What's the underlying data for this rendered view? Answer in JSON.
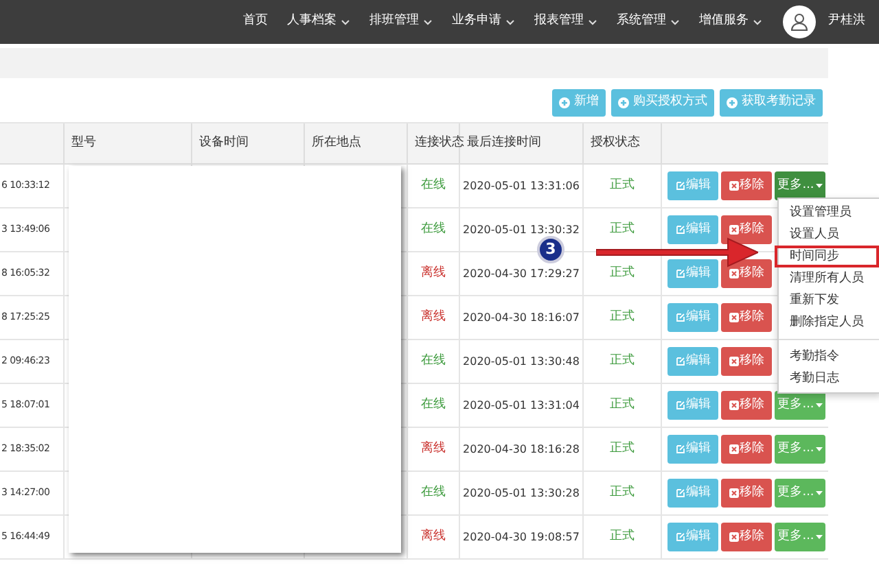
{
  "nav": {
    "items": [
      {
        "label": "首页",
        "dropdown": false
      },
      {
        "label": "人事档案",
        "dropdown": true
      },
      {
        "label": "排班管理",
        "dropdown": true
      },
      {
        "label": "业务申请",
        "dropdown": true
      },
      {
        "label": "报表管理",
        "dropdown": true
      },
      {
        "label": "系统管理",
        "dropdown": true
      },
      {
        "label": "增值服务",
        "dropdown": true
      }
    ],
    "user": "尹桂洪"
  },
  "toolbar": [
    "新增",
    "购买授权方式",
    "获取考勤记录"
  ],
  "table": {
    "columns": [
      "型号",
      "设备时间",
      "所在地点",
      "连接状态",
      "最后连接时间",
      "授权状态"
    ],
    "rows": [
      {
        "column_1": "6 10:33:12",
        "online": true,
        "status": "在线",
        "last_connected": "2020-05-01 13:31:06",
        "auth": "正式",
        "edit": "编辑",
        "remove": "移除",
        "more": {
          "label": "更多...",
          "selected": true
        }
      },
      {
        "column_1": "3 13:49:06",
        "online": true,
        "status": "在线",
        "last_connected": "2020-05-01 13:30:32",
        "auth": "正式",
        "edit": "编辑",
        "remove": "移除"
      },
      {
        "column_1": "8 16:05:32",
        "online": false,
        "status": "离线",
        "last_connected": "2020-04-30 17:29:27",
        "auth": "正式",
        "edit": "编辑",
        "remove": "移除"
      },
      {
        "column_1": "8 17:25:25",
        "online": false,
        "status": "离线",
        "last_connected": "2020-04-30 18:16:07",
        "auth": "正式",
        "edit": "编辑",
        "remove": "移除"
      },
      {
        "column_1": "2 09:46:23",
        "online": true,
        "status": "在线",
        "last_connected": "2020-05-01 13:30:48",
        "auth": "正式",
        "edit": "编辑",
        "remove": "移除"
      },
      {
        "column_1": "5 18:07:01",
        "online": true,
        "status": "在线",
        "last_connected": "2020-05-01 13:31:04",
        "auth": "正式",
        "edit": "编辑",
        "remove": "移除",
        "more": {
          "label": "更多...",
          "selected": false
        }
      },
      {
        "column_1": "2 18:35:02",
        "online": false,
        "status": "离线",
        "last_connected": "2020-04-30 18:16:28",
        "auth": "正式",
        "edit": "编辑",
        "remove": "移除",
        "more": {
          "label": "更多...",
          "selected": false
        }
      },
      {
        "column_1": "3 14:27:00",
        "online": true,
        "status": "在线",
        "last_connected": "2020-05-01 13:30:28",
        "auth": "正式",
        "edit": "编辑",
        "remove": "移除",
        "more": {
          "label": "更多...",
          "selected": false
        }
      },
      {
        "column_1": "5 16:44:49",
        "online": false,
        "status": "离线",
        "last_connected": "2020-04-30 19:08:57",
        "auth": "正式",
        "edit": "编辑",
        "remove": "移除",
        "more": {
          "label": "更多...",
          "selected": false
        }
      }
    ]
  },
  "dropdown_menu": {
    "groups": [
      [
        {
          "label": "设置管理员",
          "annotated": false
        },
        {
          "label": "设置人员",
          "annotated": false
        },
        {
          "label": "时间同步",
          "annotated": true
        },
        {
          "label": "清理所有人员",
          "annotated": false
        },
        {
          "label": "重新下发",
          "annotated": false
        },
        {
          "label": "删除指定人员",
          "annotated": false
        }
      ],
      [
        {
          "label": "考勤指令",
          "annotated": false
        },
        {
          "label": "考勤日志",
          "annotated": false
        }
      ]
    ]
  },
  "annotation": {
    "badge": "3"
  }
}
